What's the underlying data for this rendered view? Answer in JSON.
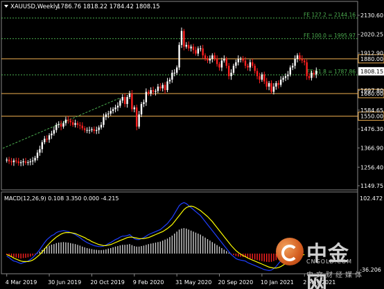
{
  "header": {
    "symbol": "XAUUSD,Weekly",
    "ohlc": "1786.76 1818.22 1784.42 1808.15"
  },
  "price_axis": {
    "labels": [
      "2130.60",
      "2020.25",
      "1912.90",
      "1808.15",
      "1697.80",
      "1584.65",
      "1476.30",
      "1366.90",
      "1256.40",
      "1149.75"
    ]
  },
  "levels": {
    "h_lines": [
      {
        "label": "1880.00",
        "value": 1880
      },
      {
        "label": "1680.00",
        "value": 1680
      },
      {
        "label": "1550.00",
        "value": 1550
      }
    ],
    "current_price_label": "1808.15",
    "current_price": 1808.15,
    "color_level": "#f0b050"
  },
  "fibo": [
    {
      "label": "FE 127.2 = 2144.16",
      "value": 2144.16
    },
    {
      "label": "FE 100.0 = 1995.97",
      "value": 1995.97
    },
    {
      "label": "FE 61.8 = 1787.86",
      "value": 1787.86
    }
  ],
  "macd": {
    "label": "MACD(12,26,9) 0.108 3.350 0.000 -4.215",
    "axis_labels": [
      "102.472",
      "-36.206"
    ]
  },
  "time_axis": {
    "labels": [
      "4 Mar 2019",
      "30 Jun 2019",
      "20 Oct 2019",
      "9 Feb 2020",
      "31 May 2020",
      "20 Sep 2020",
      "10 Jan 2021",
      "2 May 2021"
    ]
  },
  "logo": {
    "cn": "中金网",
    "en": "CNGOLD.COM",
    "sub": "中文财经媒体"
  },
  "colors": {
    "bull": "#ffffff",
    "bear": "#ff2020",
    "fibo": "#4caf50",
    "level": "#f0b050",
    "macd_main": "#1f3fff",
    "macd_signal": "#ffff00",
    "axis": "#ffffff"
  },
  "chart_data": [
    {
      "type": "candlestick",
      "title": "XAUUSD,Weekly",
      "x": [
        "4 Mar 2019",
        "30 Jun 2019",
        "20 Oct 2019",
        "9 Feb 2020",
        "31 May 2020",
        "20 Sep 2020",
        "10 Jan 2021",
        "2 May 2021"
      ],
      "series": [
        {
          "close": [
            1300,
            1290,
            1285,
            1295,
            1290,
            1280,
            1285,
            1290,
            1282,
            1285,
            1290,
            1295,
            1310,
            1340,
            1360,
            1400,
            1420,
            1415,
            1440,
            1450,
            1470,
            1500,
            1505,
            1490,
            1510,
            1530,
            1525,
            1515,
            1500,
            1510,
            1500,
            1495,
            1480,
            1470,
            1470,
            1470,
            1475,
            1465,
            1470,
            1485,
            1500,
            1545,
            1560,
            1565,
            1580,
            1590,
            1600,
            1610,
            1640,
            1660,
            1620,
            1660,
            1680,
            1590,
            1600,
            1490,
            1560,
            1620,
            1630,
            1690,
            1680,
            1700,
            1690,
            1695,
            1720,
            1710,
            1730,
            1700,
            1750,
            1760,
            1800,
            1800,
            1830,
            1960,
            2040,
            1950,
            1960,
            1940,
            1950,
            1930,
            1910,
            1940,
            1940,
            1900,
            1880,
            1870,
            1880,
            1900,
            1880,
            1850,
            1830,
            1870,
            1880,
            1840,
            1780,
            1800,
            1840,
            1860,
            1880,
            1880,
            1870,
            1840,
            1830,
            1860,
            1840,
            1810,
            1780,
            1760,
            1790,
            1750,
            1720,
            1740,
            1690,
            1720,
            1740,
            1730,
            1760,
            1770,
            1780,
            1790,
            1830,
            1840,
            1880,
            1900,
            1880,
            1870,
            1860,
            1780,
            1770,
            1800,
            1790,
            1810
          ],
          "name": ""
        }
      ],
      "ylim": [
        1149.75,
        2130.6
      ],
      "h_levels": [
        1880,
        1680,
        1550
      ],
      "fibo_levels": [
        2144.16,
        1995.97,
        1787.86
      ]
    },
    {
      "type": "line",
      "title": "MACD(12,26,9) 0.108 3.350 0.000 -4.215",
      "ylim": [
        -36.206,
        102.472
      ],
      "series": [
        {
          "name": "",
          "values": [
            -5,
            -8,
            -12,
            -15,
            -16,
            -18,
            -20,
            -18,
            -17,
            -15,
            -12,
            -8,
            -3,
            2,
            8,
            15,
            22,
            28,
            32,
            36,
            38,
            42,
            44,
            45,
            46,
            45,
            44,
            42,
            40,
            38,
            35,
            32,
            28,
            25,
            22,
            20,
            18,
            16,
            15,
            14,
            14,
            15,
            17,
            20,
            22,
            25,
            28,
            30,
            33,
            35,
            35,
            36,
            38,
            34,
            30,
            28,
            28,
            30,
            32,
            35,
            38,
            40,
            42,
            44,
            46,
            48,
            52,
            56,
            60,
            66,
            72,
            80,
            88,
            96,
            100,
            102,
            100,
            96,
            92,
            88,
            84,
            80,
            76,
            70,
            64,
            58,
            52,
            46,
            40,
            34,
            28,
            22,
            16,
            10,
            4,
            -2,
            -6,
            -10,
            -12,
            -13,
            -14,
            -15,
            -18,
            -20,
            -22,
            -24,
            -26,
            -28,
            -30,
            -32,
            -33,
            -34,
            -33,
            -30,
            -26,
            -20,
            -14,
            -8,
            -4,
            -2,
            0,
            1,
            2,
            3,
            1,
            0
          ]
        },
        {
          "name": "",
          "values": [
            -2,
            -4,
            -6,
            -9,
            -11,
            -13,
            -15,
            -16,
            -16,
            -16,
            -15,
            -13,
            -10,
            -6,
            -2,
            3,
            9,
            15,
            20,
            25,
            29,
            33,
            36,
            39,
            41,
            42,
            42,
            42,
            41,
            40,
            38,
            36,
            34,
            32,
            29,
            27,
            24,
            22,
            20,
            18,
            17,
            16,
            16,
            17,
            18,
            20,
            22,
            24,
            26,
            28,
            30,
            32,
            33,
            33,
            32,
            31,
            30,
            30,
            30,
            31,
            32,
            34,
            36,
            38,
            40,
            42,
            44,
            47,
            50,
            54,
            58,
            64,
            70,
            76,
            82,
            88,
            92,
            94,
            95,
            94,
            92,
            89,
            86,
            82,
            78,
            74,
            69,
            64,
            58,
            52,
            46,
            40,
            34,
            28,
            22,
            16,
            11,
            6,
            2,
            -1,
            -4,
            -6,
            -9,
            -11,
            -13,
            -15,
            -17,
            -19,
            -21,
            -23,
            -25,
            -27,
            -28,
            -29,
            -29,
            -28,
            -26,
            -23,
            -20,
            -17,
            -14,
            -11,
            -8,
            -6,
            -4,
            -3,
            -2
          ]
        }
      ]
    }
  ]
}
